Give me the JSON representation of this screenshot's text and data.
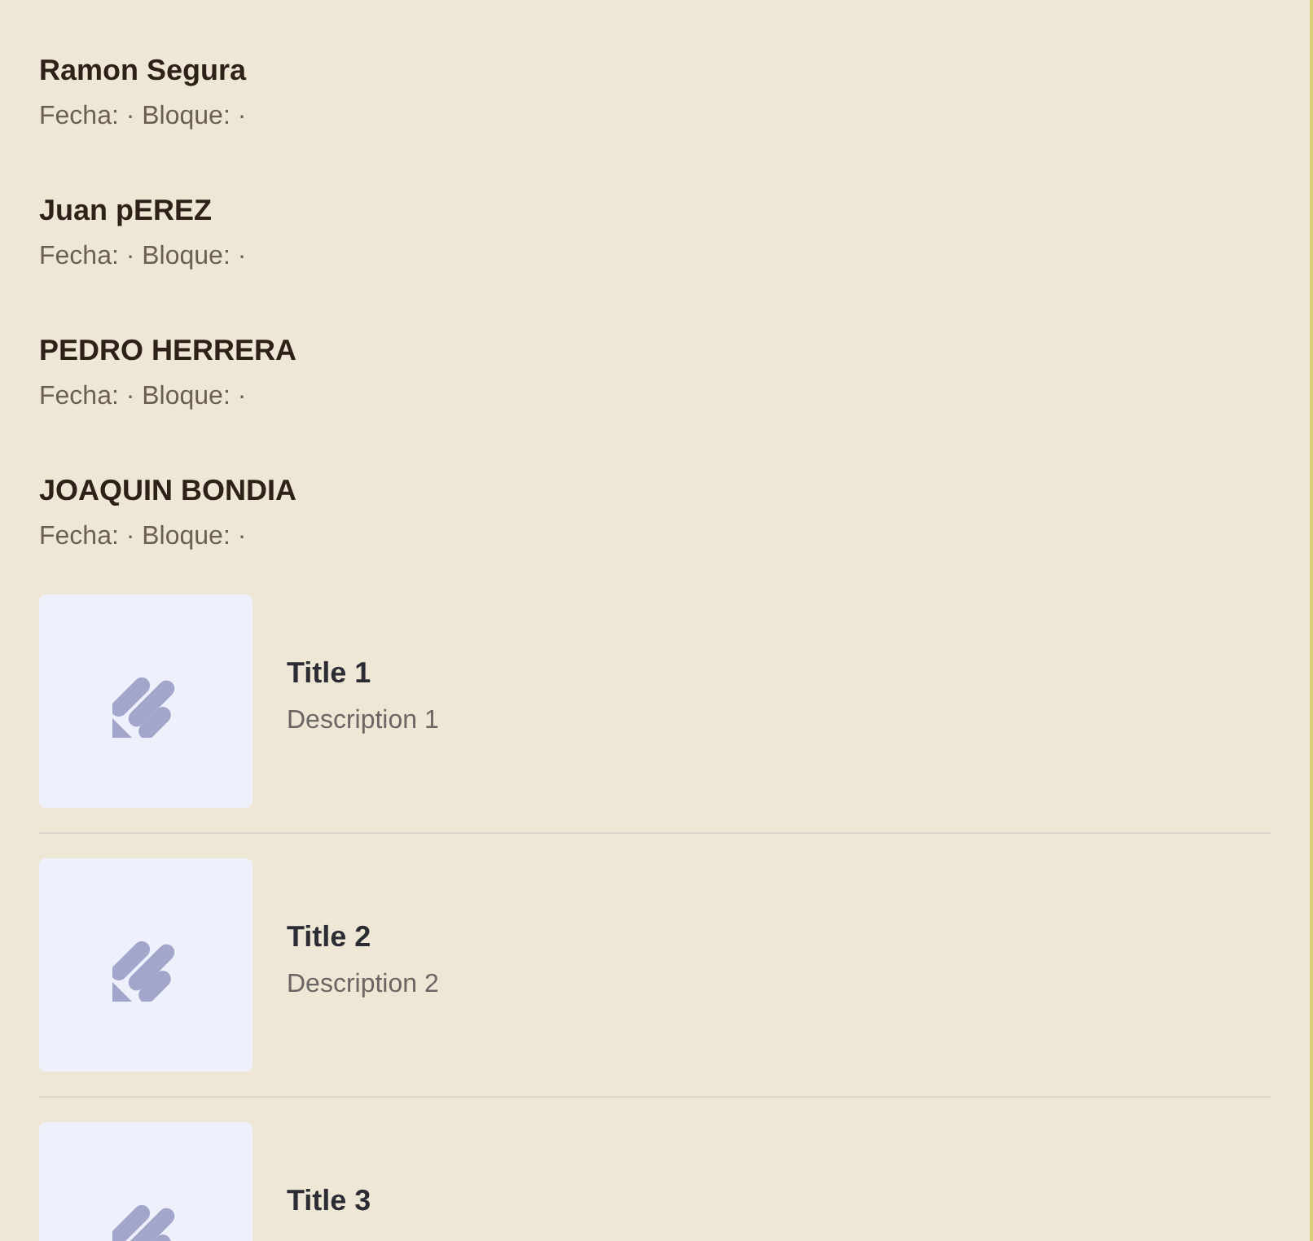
{
  "people": [
    {
      "name": "Ramon Segura",
      "meta": "Fecha: · Bloque: ·"
    },
    {
      "name": "Juan pEREZ",
      "meta": "Fecha: · Bloque: ·"
    },
    {
      "name": "PEDRO HERRERA",
      "meta": "Fecha: · Bloque: ·"
    },
    {
      "name": "JOAQUIN BONDIA",
      "meta": "Fecha: · Bloque: ·"
    }
  ],
  "cards": [
    {
      "title": "Title 1",
      "description": "Description 1"
    },
    {
      "title": "Title 2",
      "description": "Description 2"
    },
    {
      "title": "Title 3"
    }
  ]
}
